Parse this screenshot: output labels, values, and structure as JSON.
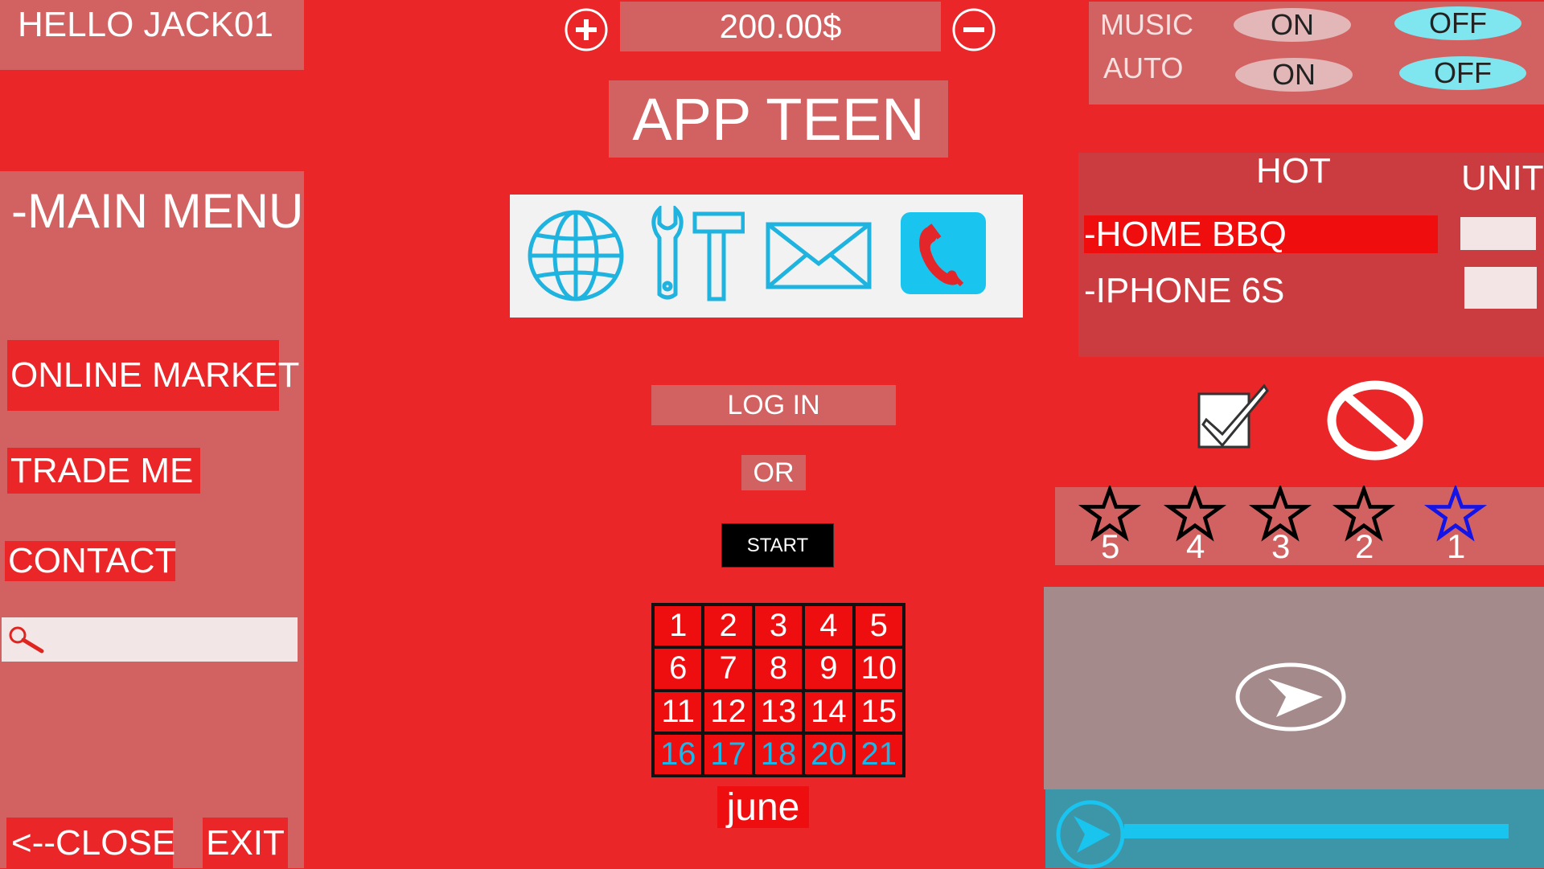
{
  "header": {
    "greeting": "HELLO JACK01",
    "balance": "200.00$",
    "app_title": "APP TEEN"
  },
  "sidebar": {
    "title": "-MAIN MENU",
    "items": [
      {
        "label": "ONLINE MARKET"
      },
      {
        "label": "TRADE ME"
      },
      {
        "label": "CONTACT"
      }
    ],
    "close_label": "<--CLOSE",
    "exit_label": "EXIT"
  },
  "icons": [
    "globe-icon",
    "tools-icon",
    "mail-icon",
    "phone-icon"
  ],
  "login": {
    "login_label": "LOG IN",
    "or_label": "OR",
    "start_label": "START"
  },
  "calendar": {
    "month": "june",
    "days": [
      "1",
      "2",
      "3",
      "4",
      "5",
      "6",
      "7",
      "8",
      "9",
      "10",
      "11",
      "12",
      "13",
      "14",
      "15",
      "16",
      "17",
      "18",
      "20",
      "21"
    ],
    "highlight_days": [
      "16",
      "17",
      "18",
      "20",
      "21"
    ]
  },
  "settings": {
    "music_label": "MUSIC",
    "auto_label": "AUTO",
    "on_label": "ON",
    "off_label": "OFF"
  },
  "hot": {
    "header": "HOT",
    "unit_header": "UNIT",
    "items": [
      {
        "label": "-HOME BBQ",
        "selected": true
      },
      {
        "label": "-IPHONE 6S",
        "selected": false
      }
    ]
  },
  "rating": {
    "stars": [
      "5",
      "4",
      "3",
      "2",
      "1"
    ],
    "selected": "1",
    "selected_color": "#1414e6"
  },
  "colors": {
    "background": "#ea2628",
    "panel": "#d26262",
    "accent_blue": "#19c4ef"
  }
}
